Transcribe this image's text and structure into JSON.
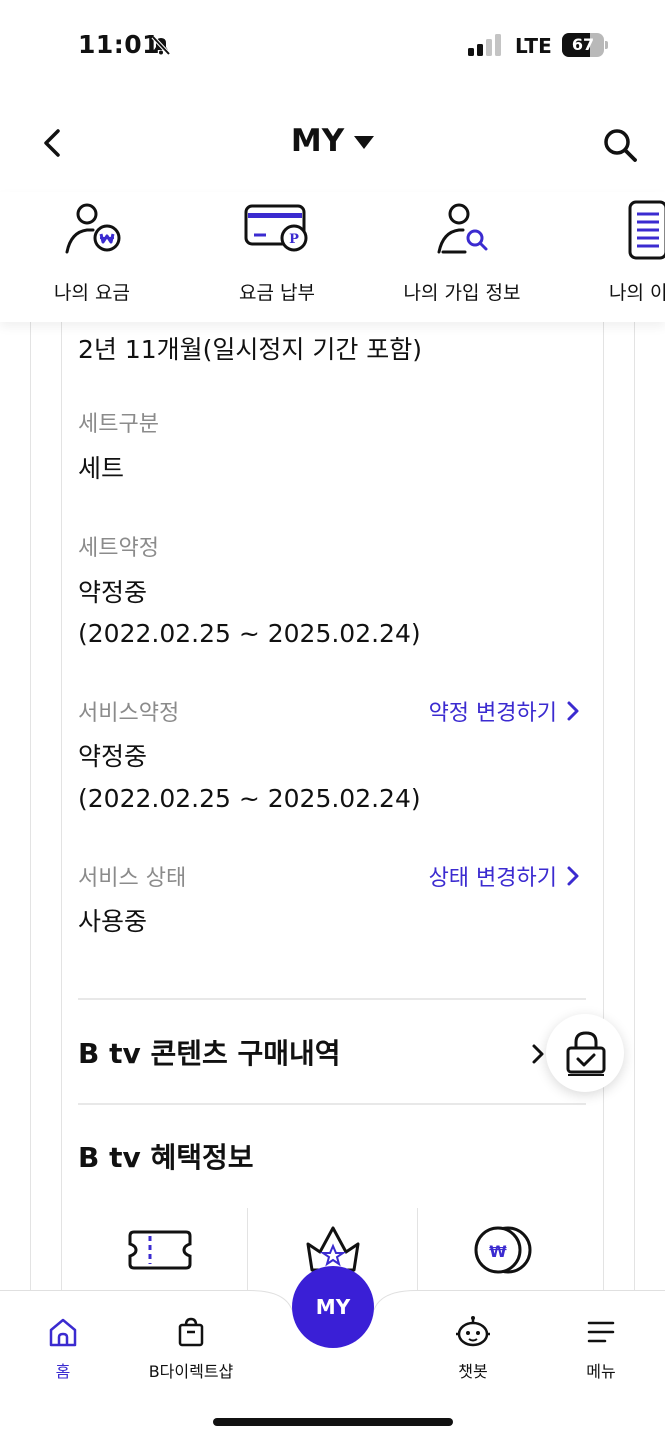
{
  "status_bar": {
    "time": "11:01",
    "network": "LTE",
    "battery": "67",
    "battery_level": 0.67
  },
  "header": {
    "title": "MY"
  },
  "quick_menu": [
    {
      "label": "나의 요금",
      "icon": "user-coin-icon"
    },
    {
      "label": "요금 납부",
      "icon": "card-pay-icon"
    },
    {
      "label": "나의 가입 정보",
      "icon": "user-search-icon"
    },
    {
      "label": "나의 이용",
      "icon": "document-list-icon"
    }
  ],
  "contract": {
    "period": "2년 11개월(일시정지 기간 포함)",
    "set_type_label": "세트구분",
    "set_type_value": "세트",
    "set_contract_label": "세트약정",
    "set_contract_status": "약정중",
    "set_contract_range": "(2022.02.25 ~ 2025.02.24)",
    "service_contract_label": "서비스약정",
    "service_contract_link": "약정 변경하기",
    "service_contract_status": "약정중",
    "service_contract_range": "(2022.02.25 ~ 2025.02.24)",
    "service_state_label": "서비스 상태",
    "service_state_link": "상태 변경하기",
    "service_state_value": "사용중"
  },
  "sections": {
    "purchase_history": "B tv 콘텐츠 구매내역",
    "benefits": "B tv 혜택정보"
  },
  "benefit_icons": [
    "ticket-icon",
    "crown-star-icon",
    "won-coins-icon"
  ],
  "bottom_nav": {
    "home": "홈",
    "shop": "B다이렉트샵",
    "my": "MY",
    "chatbot": "챗봇",
    "menu": "메뉴"
  },
  "colors": {
    "accent": "#3b2bd0",
    "my_button": "#3a1fd6"
  }
}
